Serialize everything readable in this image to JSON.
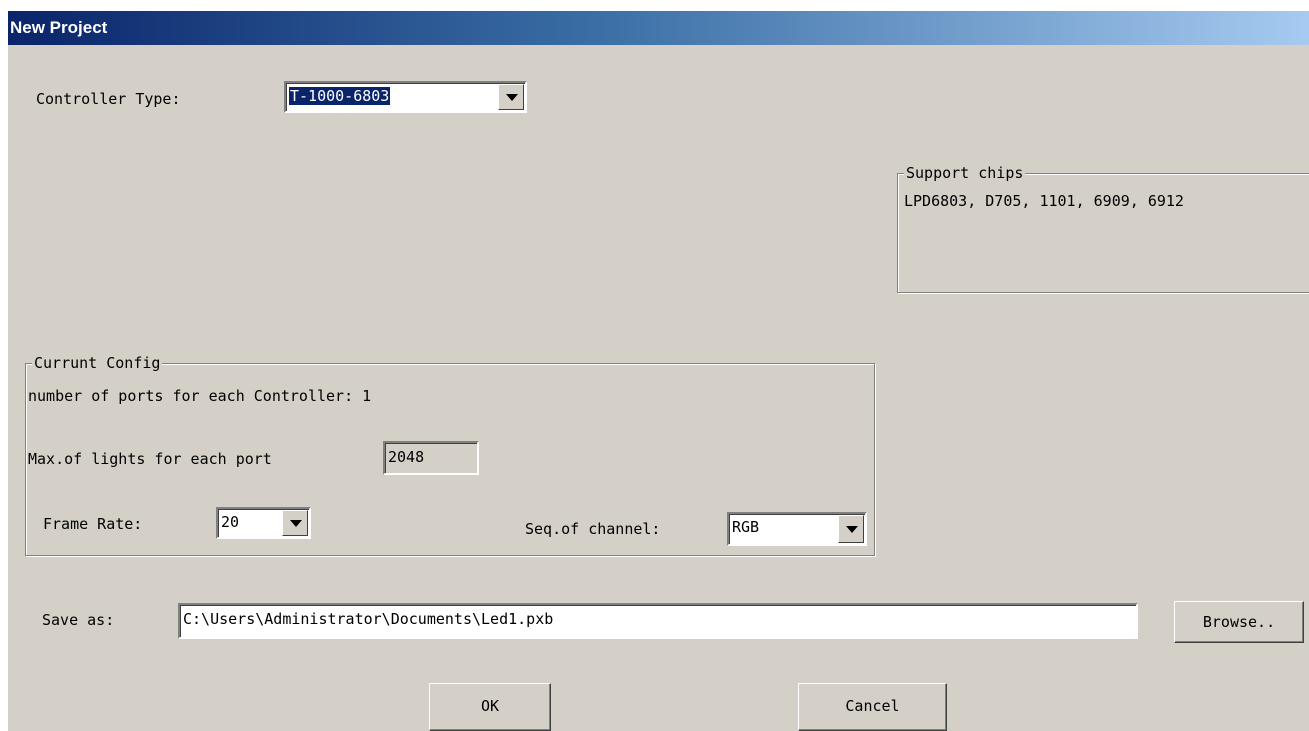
{
  "window": {
    "title": "New Project"
  },
  "controller_type": {
    "label": "Controller Type:",
    "value": "T-1000-6803"
  },
  "support_chips": {
    "title": "Support chips",
    "text": "LPD6803, D705, 1101, 6909, 6912"
  },
  "current_config": {
    "title": "Currunt Config",
    "ports_label": "number of ports for each Controller:",
    "ports_value": "1",
    "max_lights_label": "Max.of lights for each port",
    "max_lights_value": "2048",
    "frame_rate_label": "Frame Rate:",
    "frame_rate_value": "20",
    "seq_channel_label": "Seq.of channel:",
    "seq_channel_value": "RGB"
  },
  "save_as": {
    "label": "Save as:",
    "path": "C:\\Users\\Administrator\\Documents\\Led1.pxb",
    "browse_label": "Browse.."
  },
  "buttons": {
    "ok_label": "OK",
    "cancel_label": "Cancel"
  },
  "colors": {
    "dialog_face": "#d4d0c8",
    "title_start": "#0a246a",
    "title_end": "#a6caf0",
    "selection": "#0a246a"
  },
  "icons": {
    "dropdown": "chevron-down-icon"
  }
}
